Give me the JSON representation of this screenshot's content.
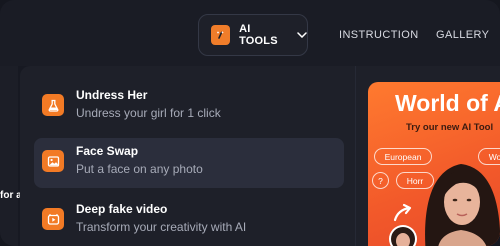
{
  "header": {
    "ai_tools_label": "AI TOOLS",
    "nav": [
      "INSTRUCTION",
      "GALLERY"
    ]
  },
  "side_fragment": "for a",
  "menu": {
    "items": [
      {
        "title": "Undress Her",
        "subtitle": "Undress your girl for 1 click",
        "icon": "flask-icon",
        "active": false
      },
      {
        "title": "Face Swap",
        "subtitle": "Put a face on any photo",
        "icon": "image-icon",
        "active": true
      },
      {
        "title": "Deep fake video",
        "subtitle": "Transform your creativity with AI",
        "icon": "video-icon",
        "active": false
      }
    ]
  },
  "promo": {
    "title": "World of A",
    "subtitle": "Try our new AI Tool",
    "chips": [
      "European",
      "Wo",
      "?",
      "Horr"
    ]
  },
  "colors": {
    "accent": "#f27a25",
    "background": "#171922",
    "menu_bg": "#1e2029",
    "active_item": "#2b2e3c"
  }
}
